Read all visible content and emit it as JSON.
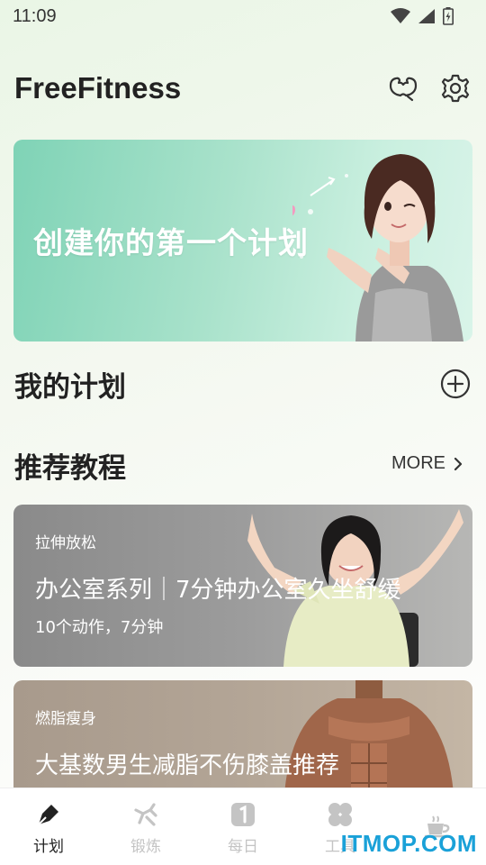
{
  "status_bar": {
    "time": "11:09"
  },
  "header": {
    "title": "FreeFitness",
    "icons": [
      "muscle-icon",
      "gear-icon"
    ]
  },
  "banner": {
    "text": "创建你的第一个计划"
  },
  "my_plans": {
    "title": "我的计划",
    "add_icon": "plus-circle-icon"
  },
  "recommended": {
    "title": "推荐教程",
    "more_label": "MORE",
    "cards": [
      {
        "category": "拉伸放松",
        "title": "办公室系列｜7分钟办公室久坐舒缓",
        "meta": "10个动作，7分钟"
      },
      {
        "category": "燃脂瘦身",
        "title": "大基数男生减脂不伤膝盖推荐",
        "meta": ""
      }
    ]
  },
  "bottom_nav": {
    "items": [
      {
        "label": "计划",
        "icon": "pen-icon",
        "active": true
      },
      {
        "label": "锻炼",
        "icon": "running-icon",
        "active": false
      },
      {
        "label": "每日",
        "icon": "calendar-one-icon",
        "active": false
      },
      {
        "label": "工具",
        "icon": "clover-icon",
        "active": false
      },
      {
        "label": "",
        "icon": "coffee-icon",
        "active": false
      }
    ]
  },
  "watermark": "ITMOP.COM",
  "colors": {
    "banner_start": "#7fd3b6",
    "accent_text": "#222222",
    "nav_inactive": "#c4c4c4",
    "watermark": "#1aa1d8"
  }
}
